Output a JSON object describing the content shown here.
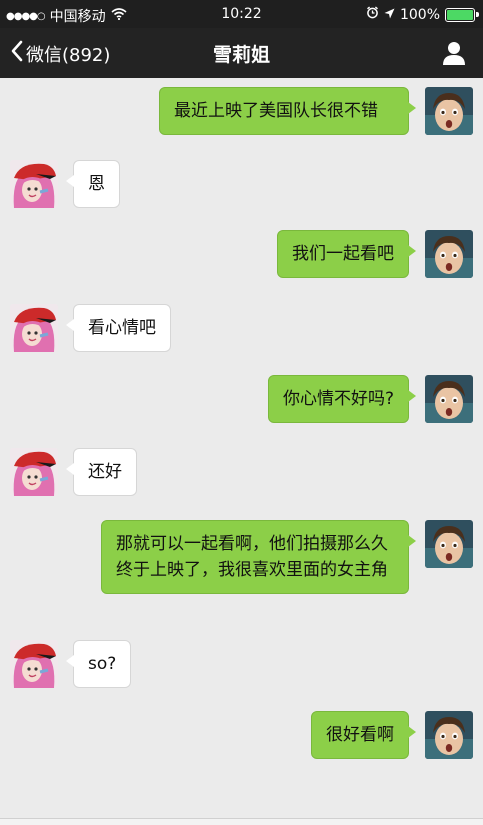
{
  "status_bar": {
    "signal_dots": "●●●●○",
    "carrier": "中国移动",
    "time": "10:22",
    "battery_percent": "100%",
    "battery_level": 1.0
  },
  "nav": {
    "back_label": "微信(892)",
    "title": "雪莉姐",
    "profile_icon": "person-icon"
  },
  "colors": {
    "sent_bubble": "#8ccf48",
    "received_bubble": "#ffffff",
    "background": "#ebebeb",
    "nav_bar": "#232323"
  },
  "messages": [
    {
      "side": "right",
      "text": "最近上映了美国队长很不错"
    },
    {
      "side": "left",
      "text": "恩"
    },
    {
      "side": "right",
      "text": "我们一起看吧"
    },
    {
      "side": "left",
      "text": "看心情吧"
    },
    {
      "side": "right",
      "text": "你心情不好吗?"
    },
    {
      "side": "left",
      "text": "还好"
    },
    {
      "side": "right",
      "text": "那就可以一起看啊，他们拍摄那么久终于上映了，我很喜欢里面的女主角"
    },
    {
      "side": "left",
      "text": "so?"
    },
    {
      "side": "right",
      "text": "很好看啊"
    }
  ]
}
